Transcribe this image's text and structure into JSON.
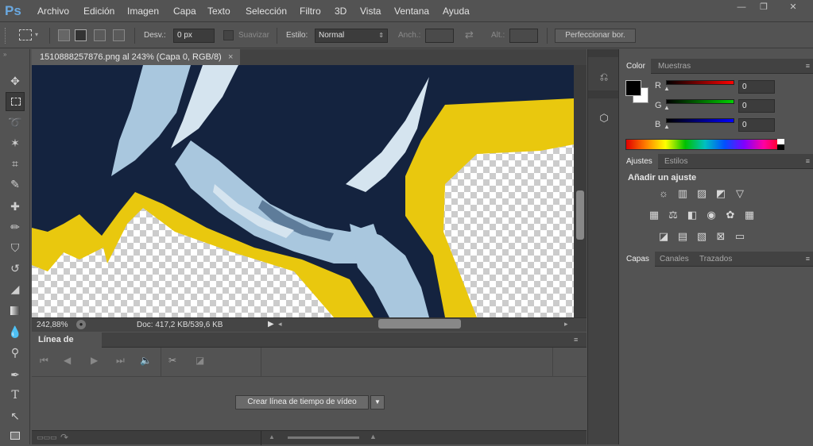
{
  "app": {
    "logo": "Ps",
    "accent": "#6aa8e0"
  },
  "menubar": {
    "items": [
      "Archivo",
      "Edición",
      "Imagen",
      "Capa",
      "Texto",
      "Selección",
      "Filtro",
      "3D",
      "Vista",
      "Ventana",
      "Ayuda"
    ]
  },
  "window_controls": {
    "minimize": "—",
    "restore": "❐",
    "close": "✕"
  },
  "options": {
    "feather_label": "Desv.:",
    "feather_value": "0 px",
    "antialias_label": "Suavizar",
    "style_label": "Estilo:",
    "style_value": "Normal",
    "width_label": "Anch.:",
    "height_label": "Alt.:",
    "refine_label": "Perfeccionar bor."
  },
  "document": {
    "tab_title": "1510888257876.png al 243% (Capa 0, RGB/8)",
    "close": "×",
    "zoom": "242,88%",
    "doc_info": "Doc: 417,2 KB/539,6 KB"
  },
  "colors": {
    "navy": "#14233f",
    "yellow": "#e9c80e",
    "lightblue": "#a9c7de",
    "paleblue": "#d5e4ef",
    "midblue": "#5e7c9a"
  },
  "timeline": {
    "tab_label": "Línea de tiempo",
    "create_button": "Crear línea de tiempo de vídeo"
  },
  "color_panel": {
    "tabs": [
      "Color",
      "Muestras"
    ],
    "channels": [
      {
        "label": "R",
        "value": "0",
        "gradient": "#ff0000"
      },
      {
        "label": "G",
        "value": "0",
        "gradient": "#00d000"
      },
      {
        "label": "B",
        "value": "0",
        "gradient": "#0000ff"
      }
    ]
  },
  "adjust_panel": {
    "tabs": [
      "Ajustes",
      "Estilos"
    ],
    "heading": "Añadir un ajuste"
  },
  "layers_panel": {
    "tabs": [
      "Capas",
      "Canales",
      "Trazados"
    ]
  },
  "tools": [
    "move-tool",
    "marquee-tool",
    "lasso-tool",
    "magic-wand-tool",
    "crop-tool",
    "eyedropper-tool",
    "healing-tool",
    "brush-tool",
    "stamp-tool",
    "history-brush-tool",
    "eraser-tool",
    "gradient-tool",
    "blur-tool",
    "dodge-tool",
    "pen-tool",
    "type-tool",
    "path-select-tool",
    "shape-tool"
  ]
}
